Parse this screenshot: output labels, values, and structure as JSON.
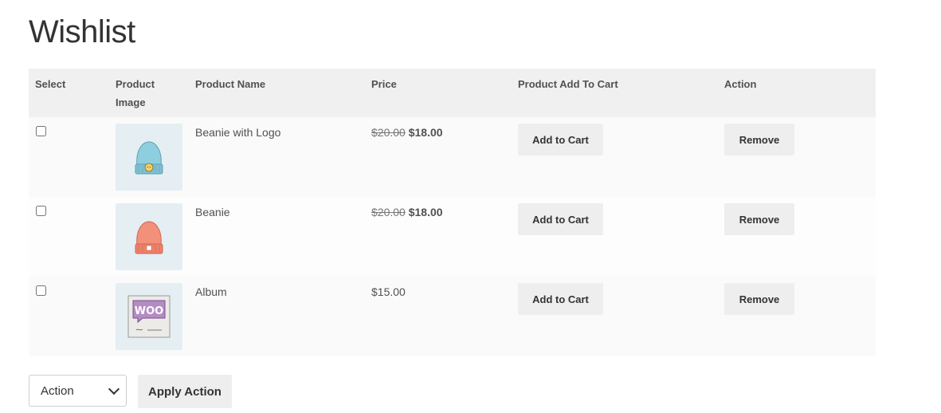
{
  "page": {
    "title": "Wishlist"
  },
  "table": {
    "headers": {
      "select": "Select",
      "image": "Product Image",
      "name": "Product Name",
      "price": "Price",
      "add_to_cart": "Product Add To Cart",
      "action": "Action"
    },
    "rows": [
      {
        "name": "Beanie with Logo",
        "price_regular": "$20.00",
        "price_sale": "$18.00",
        "image_icon": "blue-beanie-with-logo-image",
        "image_color": "#8ecfdf",
        "add_to_cart_label": "Add to Cart",
        "remove_label": "Remove",
        "checked": false
      },
      {
        "name": "Beanie",
        "price_regular": "$20.00",
        "price_sale": "$18.00",
        "image_icon": "orange-beanie-image",
        "image_color": "#f3907a",
        "add_to_cart_label": "Add to Cart",
        "remove_label": "Remove",
        "checked": false
      },
      {
        "name": "Album",
        "price": "$15.00",
        "image_icon": "woo-album-image",
        "image_color": "#9b6fa8",
        "add_to_cart_label": "Add to Cart",
        "remove_label": "Remove",
        "checked": false
      }
    ]
  },
  "bulk_actions": {
    "select_value": "Action",
    "apply_label": "Apply Action"
  },
  "colors": {
    "header_bg": "#f0f0f0",
    "row_bg": "#fafafa",
    "button_bg": "#eeeeee",
    "text": "#515151"
  }
}
